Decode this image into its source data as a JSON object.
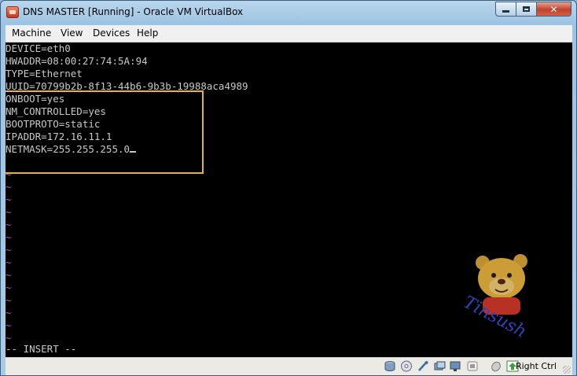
{
  "window": {
    "title": "DNS MASTER [Running] - Oracle VM VirtualBox"
  },
  "menubar": {
    "items": [
      "Machine",
      "View",
      "Devices",
      "Help"
    ]
  },
  "terminal": {
    "lines": [
      "DEVICE=eth0",
      "HWADDR=08:00:27:74:5A:94",
      "TYPE=Ethernet",
      "UUID=70799b2b-8f13-44b6-9b3b-19988aca4989",
      "ONBOOT=yes",
      "NM_CONTROLLED=yes",
      "BOOTPROTO=static",
      "IPADDR=172.16.11.1",
      "NETMASK=255.255.255.0"
    ],
    "empty_line_marker": "~",
    "mode": "-- INSERT --",
    "watermark": "Tinsush"
  },
  "statusbar": {
    "icons": [
      "hard-disk-icon",
      "optical-drive-icon",
      "usb-icon",
      "shared-folders-icon",
      "display-icon",
      "network-icon",
      "mouse-integration-icon",
      "keyboard-capture-icon"
    ],
    "host_key": "Right Ctrl"
  },
  "colors": {
    "highlight_border": "#e6b81f",
    "terminal_text": "#c8c8c8",
    "tilde": "#cc44cc",
    "terminal_bg": "#000000"
  }
}
